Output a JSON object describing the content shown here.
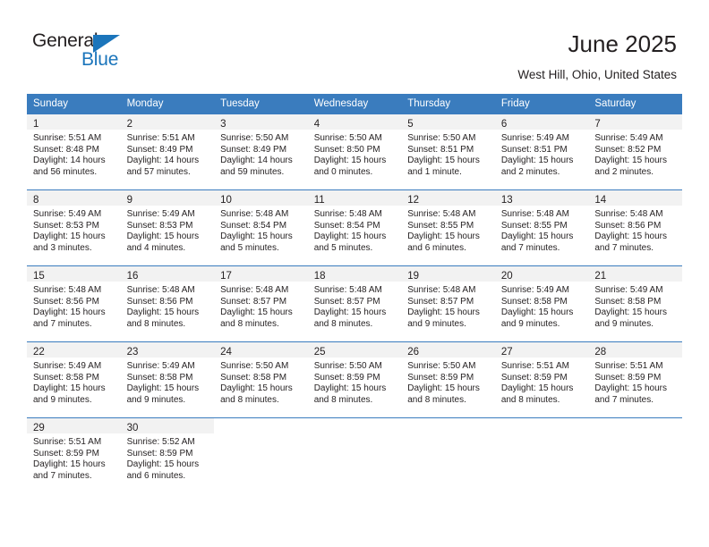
{
  "logo": {
    "word1": "General",
    "word2": "Blue",
    "triangle_color": "#1b75bb",
    "icon": "triangle-icon"
  },
  "header": {
    "title": "June 2025",
    "subtitle": "West Hill, Ohio, United States"
  },
  "theme": {
    "header_bg": "#3a7cbe",
    "header_text": "#ffffff",
    "daynum_bg": "#f2f2f2",
    "body_text": "#231f20",
    "page_bg": "#ffffff"
  },
  "calendar": {
    "weekday_headers": [
      "Sunday",
      "Monday",
      "Tuesday",
      "Wednesday",
      "Thursday",
      "Friday",
      "Saturday"
    ],
    "labels": {
      "sunrise": "Sunrise:",
      "sunset": "Sunset:",
      "daylight": "Daylight:"
    },
    "weeks": [
      [
        {
          "day": "1",
          "sunrise": "Sunrise: 5:51 AM",
          "sunset": "Sunset: 8:48 PM",
          "daylight_line1": "Daylight: 14 hours",
          "daylight_line2": "and 56 minutes."
        },
        {
          "day": "2",
          "sunrise": "Sunrise: 5:51 AM",
          "sunset": "Sunset: 8:49 PM",
          "daylight_line1": "Daylight: 14 hours",
          "daylight_line2": "and 57 minutes."
        },
        {
          "day": "3",
          "sunrise": "Sunrise: 5:50 AM",
          "sunset": "Sunset: 8:49 PM",
          "daylight_line1": "Daylight: 14 hours",
          "daylight_line2": "and 59 minutes."
        },
        {
          "day": "4",
          "sunrise": "Sunrise: 5:50 AM",
          "sunset": "Sunset: 8:50 PM",
          "daylight_line1": "Daylight: 15 hours",
          "daylight_line2": "and 0 minutes."
        },
        {
          "day": "5",
          "sunrise": "Sunrise: 5:50 AM",
          "sunset": "Sunset: 8:51 PM",
          "daylight_line1": "Daylight: 15 hours",
          "daylight_line2": "and 1 minute."
        },
        {
          "day": "6",
          "sunrise": "Sunrise: 5:49 AM",
          "sunset": "Sunset: 8:51 PM",
          "daylight_line1": "Daylight: 15 hours",
          "daylight_line2": "and 2 minutes."
        },
        {
          "day": "7",
          "sunrise": "Sunrise: 5:49 AM",
          "sunset": "Sunset: 8:52 PM",
          "daylight_line1": "Daylight: 15 hours",
          "daylight_line2": "and 2 minutes."
        }
      ],
      [
        {
          "day": "8",
          "sunrise": "Sunrise: 5:49 AM",
          "sunset": "Sunset: 8:53 PM",
          "daylight_line1": "Daylight: 15 hours",
          "daylight_line2": "and 3 minutes."
        },
        {
          "day": "9",
          "sunrise": "Sunrise: 5:49 AM",
          "sunset": "Sunset: 8:53 PM",
          "daylight_line1": "Daylight: 15 hours",
          "daylight_line2": "and 4 minutes."
        },
        {
          "day": "10",
          "sunrise": "Sunrise: 5:48 AM",
          "sunset": "Sunset: 8:54 PM",
          "daylight_line1": "Daylight: 15 hours",
          "daylight_line2": "and 5 minutes."
        },
        {
          "day": "11",
          "sunrise": "Sunrise: 5:48 AM",
          "sunset": "Sunset: 8:54 PM",
          "daylight_line1": "Daylight: 15 hours",
          "daylight_line2": "and 5 minutes."
        },
        {
          "day": "12",
          "sunrise": "Sunrise: 5:48 AM",
          "sunset": "Sunset: 8:55 PM",
          "daylight_line1": "Daylight: 15 hours",
          "daylight_line2": "and 6 minutes."
        },
        {
          "day": "13",
          "sunrise": "Sunrise: 5:48 AM",
          "sunset": "Sunset: 8:55 PM",
          "daylight_line1": "Daylight: 15 hours",
          "daylight_line2": "and 7 minutes."
        },
        {
          "day": "14",
          "sunrise": "Sunrise: 5:48 AM",
          "sunset": "Sunset: 8:56 PM",
          "daylight_line1": "Daylight: 15 hours",
          "daylight_line2": "and 7 minutes."
        }
      ],
      [
        {
          "day": "15",
          "sunrise": "Sunrise: 5:48 AM",
          "sunset": "Sunset: 8:56 PM",
          "daylight_line1": "Daylight: 15 hours",
          "daylight_line2": "and 7 minutes."
        },
        {
          "day": "16",
          "sunrise": "Sunrise: 5:48 AM",
          "sunset": "Sunset: 8:56 PM",
          "daylight_line1": "Daylight: 15 hours",
          "daylight_line2": "and 8 minutes."
        },
        {
          "day": "17",
          "sunrise": "Sunrise: 5:48 AM",
          "sunset": "Sunset: 8:57 PM",
          "daylight_line1": "Daylight: 15 hours",
          "daylight_line2": "and 8 minutes."
        },
        {
          "day": "18",
          "sunrise": "Sunrise: 5:48 AM",
          "sunset": "Sunset: 8:57 PM",
          "daylight_line1": "Daylight: 15 hours",
          "daylight_line2": "and 8 minutes."
        },
        {
          "day": "19",
          "sunrise": "Sunrise: 5:48 AM",
          "sunset": "Sunset: 8:57 PM",
          "daylight_line1": "Daylight: 15 hours",
          "daylight_line2": "and 9 minutes."
        },
        {
          "day": "20",
          "sunrise": "Sunrise: 5:49 AM",
          "sunset": "Sunset: 8:58 PM",
          "daylight_line1": "Daylight: 15 hours",
          "daylight_line2": "and 9 minutes."
        },
        {
          "day": "21",
          "sunrise": "Sunrise: 5:49 AM",
          "sunset": "Sunset: 8:58 PM",
          "daylight_line1": "Daylight: 15 hours",
          "daylight_line2": "and 9 minutes."
        }
      ],
      [
        {
          "day": "22",
          "sunrise": "Sunrise: 5:49 AM",
          "sunset": "Sunset: 8:58 PM",
          "daylight_line1": "Daylight: 15 hours",
          "daylight_line2": "and 9 minutes."
        },
        {
          "day": "23",
          "sunrise": "Sunrise: 5:49 AM",
          "sunset": "Sunset: 8:58 PM",
          "daylight_line1": "Daylight: 15 hours",
          "daylight_line2": "and 9 minutes."
        },
        {
          "day": "24",
          "sunrise": "Sunrise: 5:50 AM",
          "sunset": "Sunset: 8:58 PM",
          "daylight_line1": "Daylight: 15 hours",
          "daylight_line2": "and 8 minutes."
        },
        {
          "day": "25",
          "sunrise": "Sunrise: 5:50 AM",
          "sunset": "Sunset: 8:59 PM",
          "daylight_line1": "Daylight: 15 hours",
          "daylight_line2": "and 8 minutes."
        },
        {
          "day": "26",
          "sunrise": "Sunrise: 5:50 AM",
          "sunset": "Sunset: 8:59 PM",
          "daylight_line1": "Daylight: 15 hours",
          "daylight_line2": "and 8 minutes."
        },
        {
          "day": "27",
          "sunrise": "Sunrise: 5:51 AM",
          "sunset": "Sunset: 8:59 PM",
          "daylight_line1": "Daylight: 15 hours",
          "daylight_line2": "and 8 minutes."
        },
        {
          "day": "28",
          "sunrise": "Sunrise: 5:51 AM",
          "sunset": "Sunset: 8:59 PM",
          "daylight_line1": "Daylight: 15 hours",
          "daylight_line2": "and 7 minutes."
        }
      ],
      [
        {
          "day": "29",
          "sunrise": "Sunrise: 5:51 AM",
          "sunset": "Sunset: 8:59 PM",
          "daylight_line1": "Daylight: 15 hours",
          "daylight_line2": "and 7 minutes."
        },
        {
          "day": "30",
          "sunrise": "Sunrise: 5:52 AM",
          "sunset": "Sunset: 8:59 PM",
          "daylight_line1": "Daylight: 15 hours",
          "daylight_line2": "and 6 minutes."
        },
        null,
        null,
        null,
        null,
        null
      ]
    ]
  }
}
